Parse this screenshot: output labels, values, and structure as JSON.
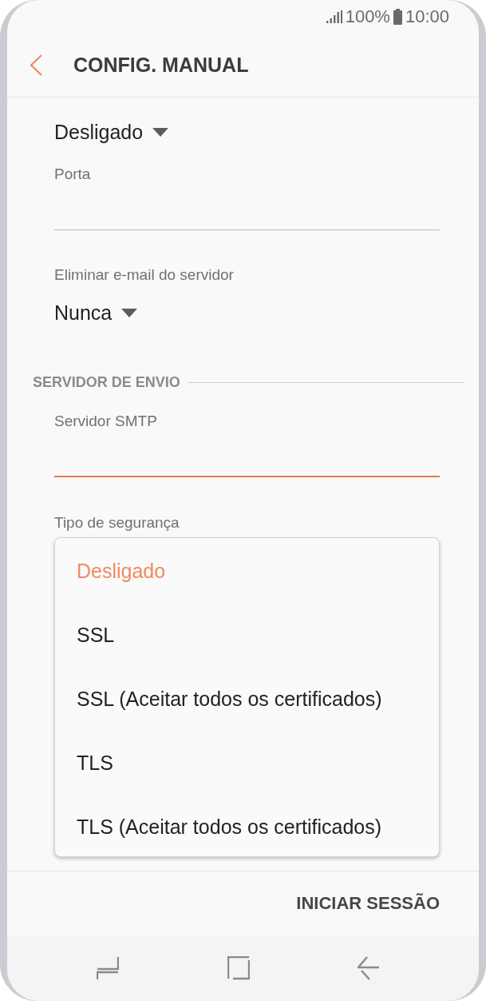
{
  "status_bar": {
    "battery": "100%",
    "time": "10:00"
  },
  "header": {
    "title": "CONFIG. MANUAL"
  },
  "incoming": [
    {
      "kind": "dropdown",
      "value": "Desligado"
    },
    {
      "kind": "text",
      "label": "Porta",
      "focused": false
    },
    {
      "kind": "dropdown",
      "label": "Eliminar e-mail do servidor",
      "value": "Nunca"
    }
  ],
  "outgoing": {
    "heading": "SERVIDOR DE ENVIO",
    "fields": [
      {
        "kind": "text",
        "label": "Servidor SMTP",
        "focused": true
      },
      {
        "kind": "label",
        "label": "Tipo de segurança"
      }
    ]
  },
  "menu": {
    "options": [
      {
        "label": "Desligado",
        "selected": true
      },
      {
        "label": "SSL",
        "selected": false
      },
      {
        "label": "SSL (Aceitar todos os certificados)",
        "selected": false
      },
      {
        "label": "TLS",
        "selected": false
      },
      {
        "label": "TLS (Aceitar todos os certificados)",
        "selected": false
      }
    ]
  },
  "action": {
    "label": "INICIAR SESSÃO"
  }
}
